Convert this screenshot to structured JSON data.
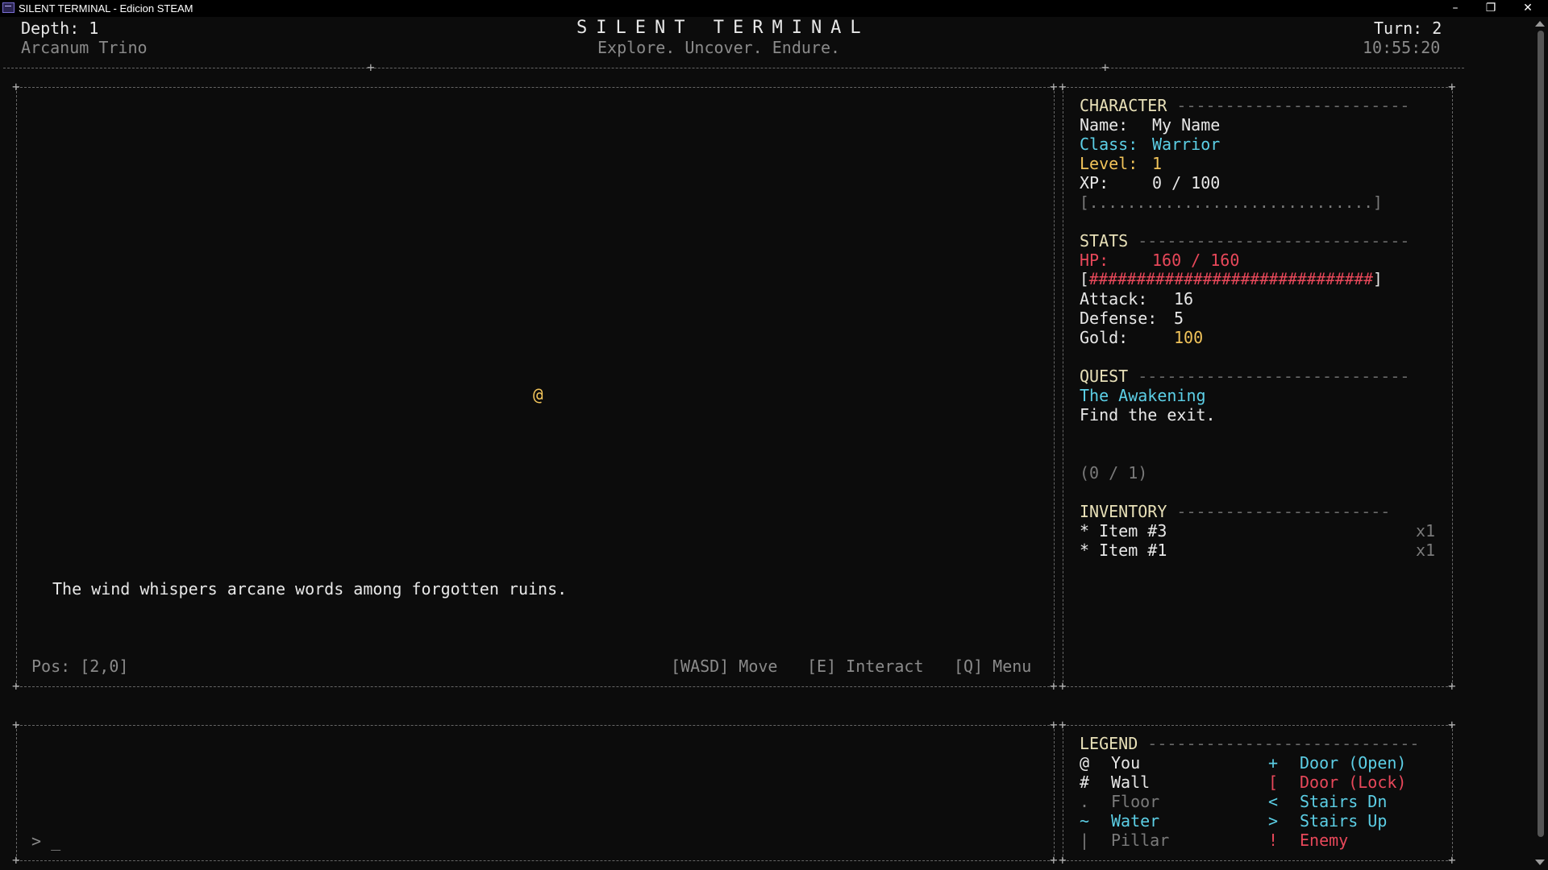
{
  "window": {
    "title": "SILENT TERMINAL - Edicion STEAM",
    "controls": {
      "minimize": "–",
      "restore": "❐",
      "close": "✕"
    }
  },
  "header": {
    "depth": "Depth: 1",
    "location": "Arcanum Trino",
    "title": "SILENT TERMINAL",
    "tagline": "Explore. Uncover. Endure.",
    "turn": "Turn: 2",
    "clock": "10:55:20"
  },
  "map": {
    "player_glyph": "@",
    "message": "The wind whispers arcane words among forgotten ruins.",
    "position": "Pos: [2,0]",
    "controls": {
      "move": "[WASD] Move",
      "interact": "[E] Interact",
      "menu": "[Q] Menu"
    }
  },
  "character": {
    "header": "CHARACTER",
    "name_label": "Name:",
    "name_value": "My Name",
    "class_label": "Class:",
    "class_value": "Warrior",
    "level_label": "Level:",
    "level_value": "1",
    "xp_label": "XP:",
    "xp_value": "0 / 100",
    "xp_bar": "[..............................]",
    "xp_fraction": 0
  },
  "stats": {
    "header": "STATS",
    "hp_label": "HP:",
    "hp_value": "160 / 160",
    "hp_bar_open": "[",
    "hp_bar_fill": "##############################",
    "hp_bar_close": "]",
    "hp_fraction": 1,
    "attack_label": "Attack:",
    "attack_value": "16",
    "defense_label": "Defense:",
    "defense_value": "5",
    "gold_label": "Gold:",
    "gold_value": "100"
  },
  "quest": {
    "header": "QUEST",
    "title": "The Awakening",
    "description": "Find the exit.",
    "progress": "(0 / 1)"
  },
  "inventory": {
    "header": "INVENTORY",
    "items": [
      {
        "bullet": "*",
        "name": "Item #3",
        "qty": "x1"
      },
      {
        "bullet": "*",
        "name": "Item #1",
        "qty": "x1"
      }
    ]
  },
  "console": {
    "prompt": "> _"
  },
  "legend": {
    "header": "LEGEND",
    "left": [
      {
        "glyph": "@",
        "label": "You"
      },
      {
        "glyph": "#",
        "label": "Wall"
      },
      {
        "glyph": ".",
        "label": "Floor"
      },
      {
        "glyph": "~",
        "label": "Water"
      },
      {
        "glyph": "|",
        "label": "Pillar"
      }
    ],
    "right": [
      {
        "glyph": "+",
        "label": "Door (Open)"
      },
      {
        "glyph": "[",
        "label": "Door (Lock)"
      },
      {
        "glyph": "<",
        "label": "Stairs Dn"
      },
      {
        "glyph": ">",
        "label": "Stairs Up"
      },
      {
        "glyph": "!",
        "label": "Enemy"
      }
    ]
  },
  "colors": {
    "background": "#0c0c0c",
    "accent_cyan": "#5ccfe6",
    "hp_red": "#e8485a",
    "gold": "#f1c35a",
    "header_text": "#e8e0b8"
  }
}
